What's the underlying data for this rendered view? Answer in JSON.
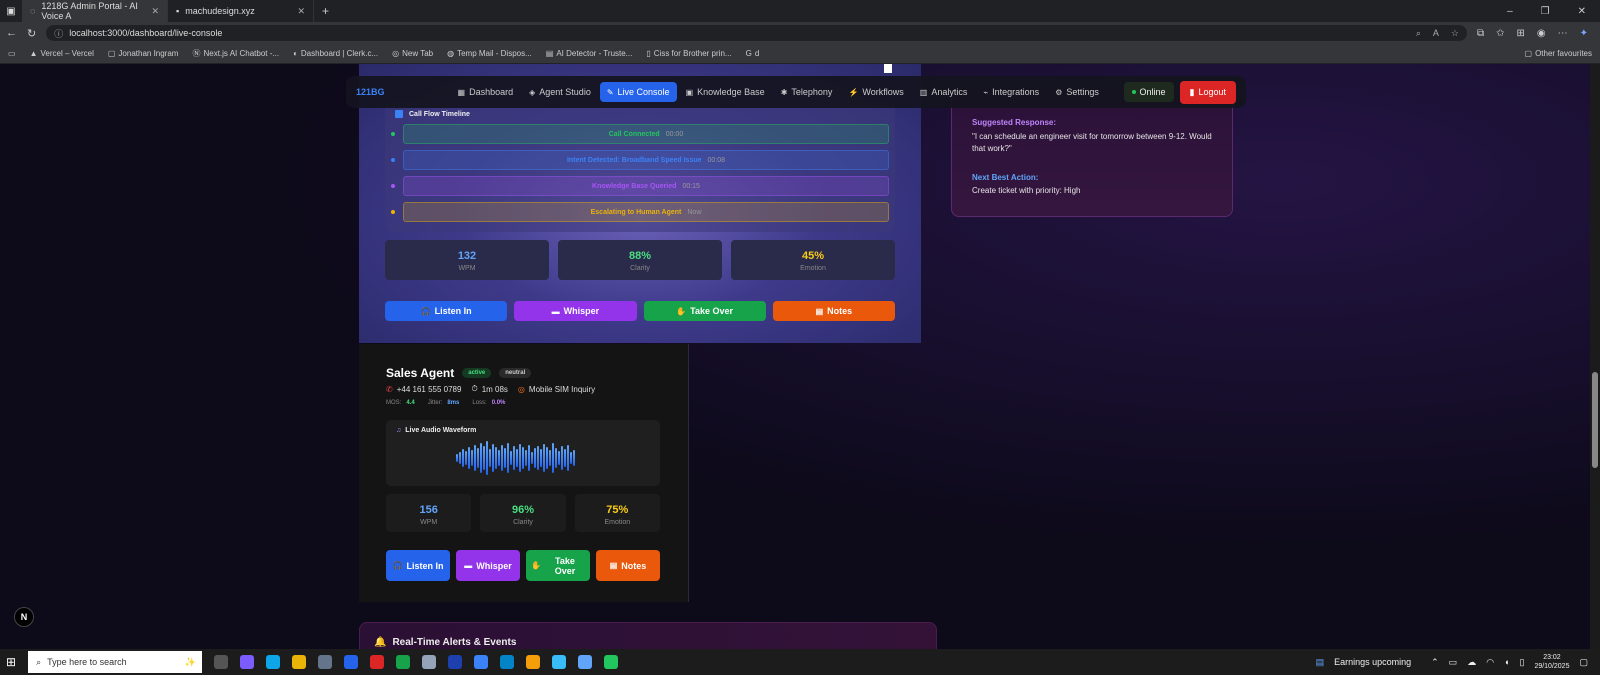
{
  "browser": {
    "tabs": [
      {
        "title": "1218G Admin Portal - AI Voice A"
      },
      {
        "title": "machudesign.xyz"
      }
    ],
    "url": "localhost:3000/dashboard/live-console",
    "bookmarks": [
      "Vercel – Vercel",
      "Jonathan Ingram",
      "Next.js AI Chatbot -...",
      "Dashboard | Clerk.c...",
      "New Tab",
      "Temp Mail - Dispos...",
      "AI Detector - Truste...",
      "Ciss for Brother prin...",
      "d"
    ],
    "other_favourites": "Other favourites"
  },
  "nav": {
    "brand": "121BG",
    "items": [
      "Dashboard",
      "Agent Studio",
      "Live Console",
      "Knowledge Base",
      "Telephony",
      "Workflows",
      "Analytics",
      "Integrations",
      "Settings"
    ],
    "active": "Live Console",
    "status": "Online",
    "logout": "Logout"
  },
  "call1": {
    "timeline_title": "Call Flow Timeline",
    "timeline": [
      {
        "label": "Call Connected",
        "time": "00:00",
        "color": "#22c55e"
      },
      {
        "label": "Intent Detected: Broadband Speed Issue",
        "time": "00:08",
        "color": "#3b82f6"
      },
      {
        "label": "Knowledge Base Queried",
        "time": "00:15",
        "color": "#a855f7"
      },
      {
        "label": "Escalating to Human Agent",
        "time": "Now",
        "color": "#eab308"
      }
    ],
    "stats": [
      {
        "value": "132",
        "label": "WPM",
        "color": "#60a5fa"
      },
      {
        "value": "88%",
        "label": "Clarity",
        "color": "#4ade80"
      },
      {
        "value": "45%",
        "label": "Emotion",
        "color": "#facc15"
      }
    ],
    "actions": [
      "Listen In",
      "Whisper",
      "Take Over",
      "Notes"
    ]
  },
  "assist": {
    "suggested_title": "Suggested Response:",
    "suggested_text": "\"I can schedule an engineer visit for tomorrow between 9-12. Would that work?\"",
    "next_title": "Next Best Action:",
    "next_text": "Create ticket with priority: High"
  },
  "call2": {
    "name": "Sales Agent",
    "badge_status": "active",
    "badge_mood": "neutral",
    "phone": "+44 161 555 0789",
    "duration": "1m 08s",
    "topic": "Mobile SIM Inquiry",
    "mos_label": "MOS:",
    "mos_value": "4.4",
    "jitter_label": "Jitter:",
    "jitter_value": "8ms",
    "loss_label": "Loss:",
    "loss_value": "0.0%",
    "waveform_title": "Live Audio Waveform",
    "stats": [
      {
        "value": "156",
        "label": "WPM",
        "color": "#60a5fa"
      },
      {
        "value": "96%",
        "label": "Clarity",
        "color": "#4ade80"
      },
      {
        "value": "75%",
        "label": "Emotion",
        "color": "#facc15"
      }
    ],
    "actions": [
      "Listen In",
      "Whisper",
      "Take Over",
      "Notes"
    ]
  },
  "alerts_title": "Real-Time Alerts & Events",
  "taskbar": {
    "search": "Type here to search",
    "weather": "Earnings upcoming",
    "time": "23:02",
    "date": "29/10/2025"
  },
  "colors": {
    "listen": "#2563eb",
    "whisper": "#9333ea",
    "takeover": "#16a34a",
    "notes": "#ea580c",
    "logout": "#dc2626"
  }
}
